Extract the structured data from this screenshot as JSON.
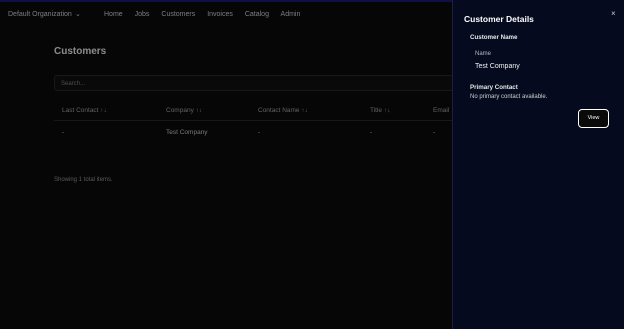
{
  "topbar": {
    "org_name": "Default Organization",
    "menu": [
      "Home",
      "Jobs",
      "Customers",
      "Invoices",
      "Catalog",
      "Admin"
    ]
  },
  "page": {
    "title": "Customers",
    "search_placeholder": "Search...",
    "table": {
      "headers": [
        "Last Contact ↑↓",
        "Company ↑↓",
        "Contact Name ↑↓",
        "Title ↑↓",
        "Email"
      ],
      "rows": [
        [
          "-",
          "Test Company",
          "-",
          "-",
          "-"
        ]
      ]
    },
    "footer_text": "Showing 1 total items."
  },
  "drawer": {
    "title": "Customer Details",
    "close_glyph": "×",
    "customer_name_heading": "Customer Name",
    "name_label": "Name",
    "name_value": "Test Company",
    "primary_contact_heading": "Primary Contact",
    "no_contact_text": "No primary contact available.",
    "view_button": "View"
  },
  "colors": {
    "page_bg": "#0b0b0c",
    "drawer_bg": "#050a1e",
    "accent_line": "#1d1a7a"
  }
}
